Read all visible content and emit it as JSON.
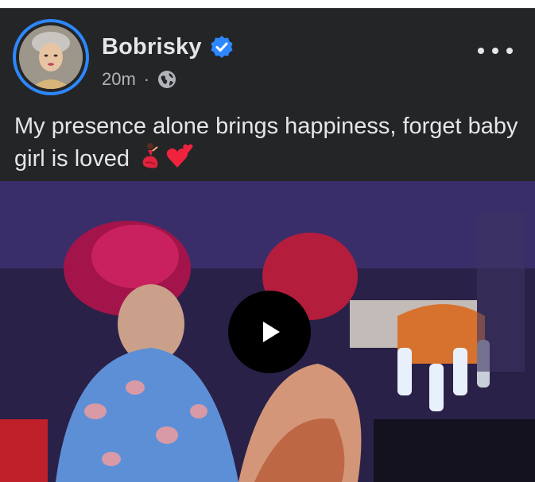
{
  "post": {
    "author_name": "Bobrisky",
    "timestamp": "20m",
    "separator": "·",
    "caption_text": "My presence alone brings happiness, forget baby girl is loved",
    "caption_emojis": [
      "dancer-emoji",
      "two-hearts-emoji"
    ],
    "verified_icon": "verified-badge-icon",
    "audience_icon": "globe-icon",
    "more_icon": "more-options-icon"
  },
  "video": {
    "play_icon": "play-icon"
  },
  "colors": {
    "background": "#242526",
    "text_primary": "#e4e6eb",
    "text_secondary": "#b0b3b8",
    "verified_blue": "#2d88ff",
    "play_button_bg": "#000000"
  }
}
